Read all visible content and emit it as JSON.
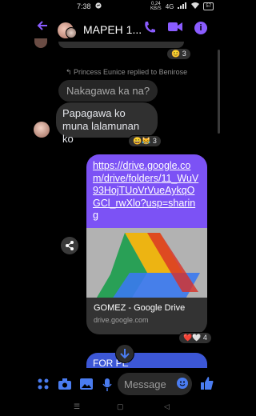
{
  "status_bar": {
    "time": "7:38",
    "messenger_indicator": "messenger-icon",
    "net_speed_value": "0.24",
    "net_speed_unit": "KB/S",
    "network_type": "4G",
    "battery": "57"
  },
  "header": {
    "title": "MAPEH 1...",
    "icons": [
      "back-arrow-icon",
      "phone-icon",
      "video-camera-icon",
      "info-icon"
    ]
  },
  "messages": {
    "top_reaction": "😊 3",
    "reply_note": "Princess Eunice replied to Benirose",
    "quoted_text": "Nakagawa ka na?",
    "reply_text": "Papagawa ko muna lalamunan ko",
    "reply_reaction": "😄😹 3",
    "link_url": "https://drive.google.com/drive/folders/11_WuV93HojTUoVrVueAykqOGCl_rwXlo?usp=sharing",
    "link_title": "GOMEZ - Google Drive",
    "link_domain": "drive.google.com",
    "link_reaction": "❤️🤍 4",
    "partial_bubble_text": "FOR PE"
  },
  "composer": {
    "placeholder": "Message",
    "icons": [
      "apps-icon",
      "camera-icon",
      "image-icon",
      "mic-icon",
      "emoji-icon",
      "like-icon"
    ]
  },
  "colors": {
    "accent": "#8a5cff",
    "link_bubble": "#7c52f5",
    "blue_bubble": "#3c57d6"
  }
}
